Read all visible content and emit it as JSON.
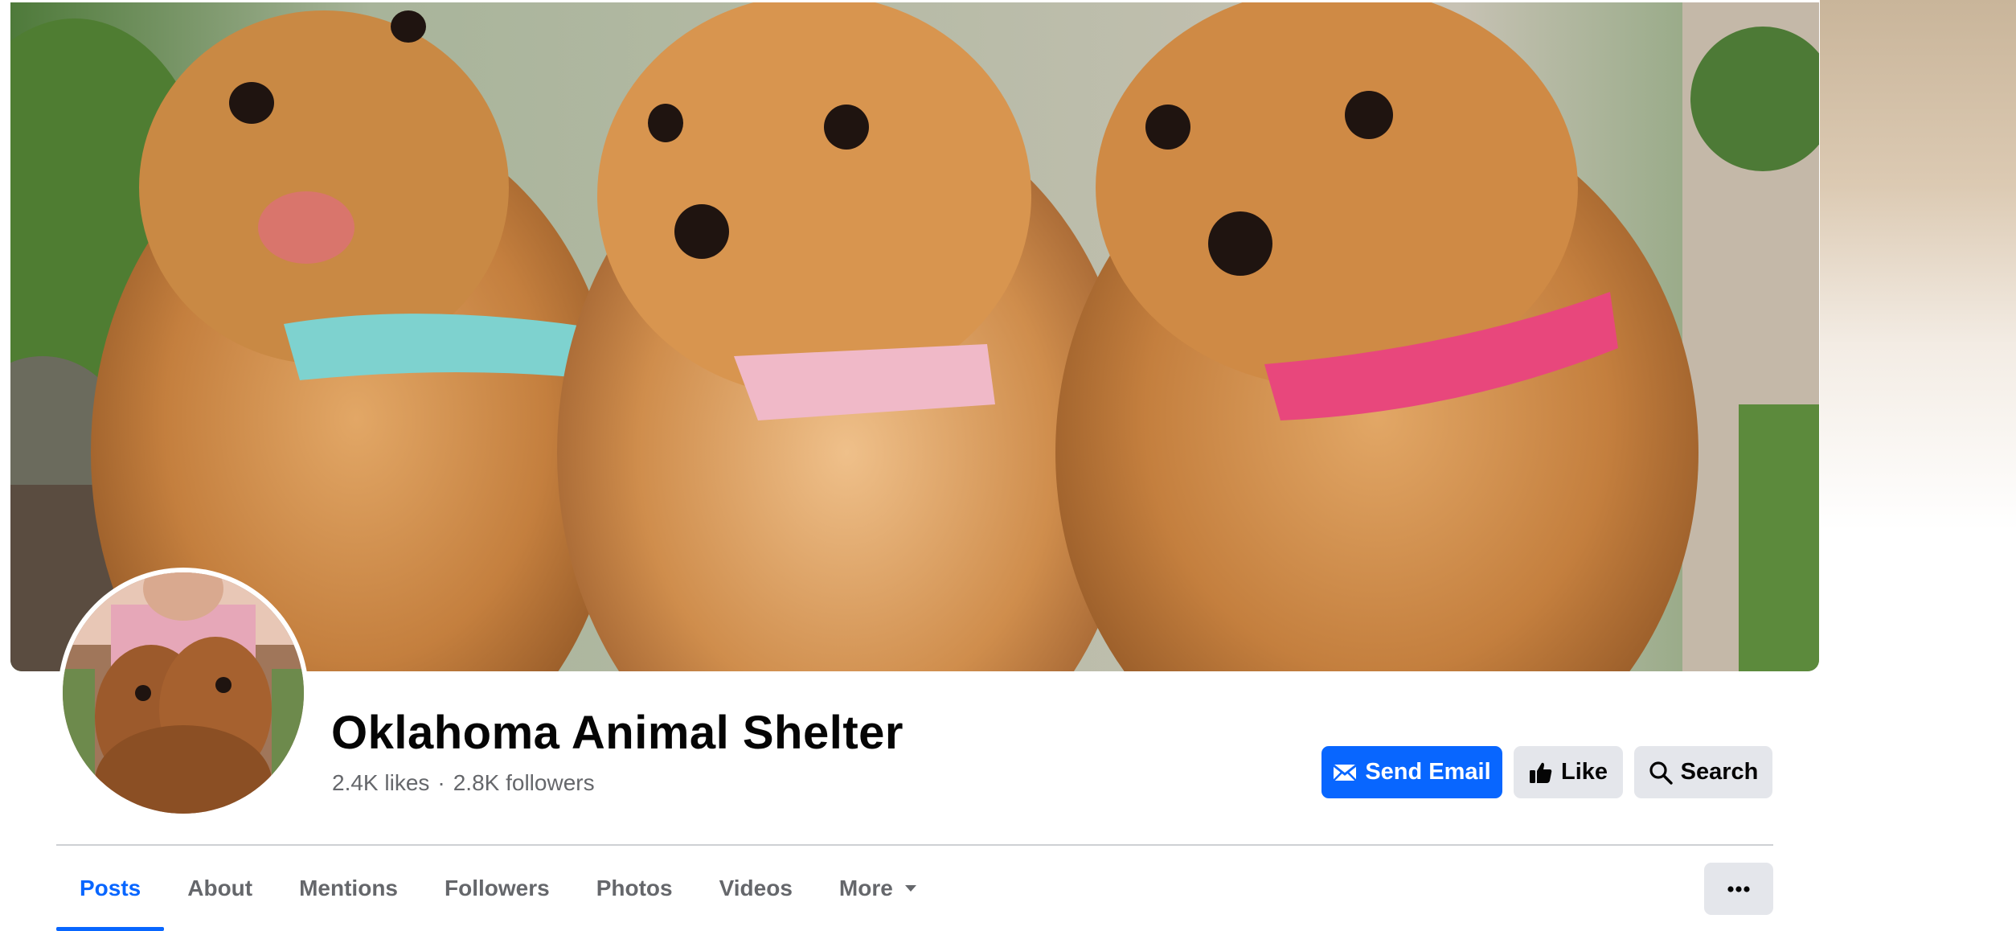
{
  "page": {
    "name": "Oklahoma Animal Shelter",
    "likes": "2.4K likes",
    "separator": "·",
    "followers": "2.8K followers"
  },
  "actions": {
    "send_email": "Send Email",
    "like": "Like",
    "search": "Search"
  },
  "tabs": [
    {
      "label": "Posts",
      "active": true
    },
    {
      "label": "About"
    },
    {
      "label": "Mentions"
    },
    {
      "label": "Followers"
    },
    {
      "label": "Photos"
    },
    {
      "label": "Videos"
    },
    {
      "label": "More"
    }
  ],
  "icons": {
    "email": "envelope-icon",
    "like": "thumbs-up-icon",
    "search": "search-icon",
    "more_caret": "caret-down-icon",
    "overflow": "more-options-icon"
  },
  "colors": {
    "accent": "#0866ff",
    "secondary_button": "#e4e6eb",
    "muted_text": "#65676b",
    "title_text": "#050505"
  }
}
